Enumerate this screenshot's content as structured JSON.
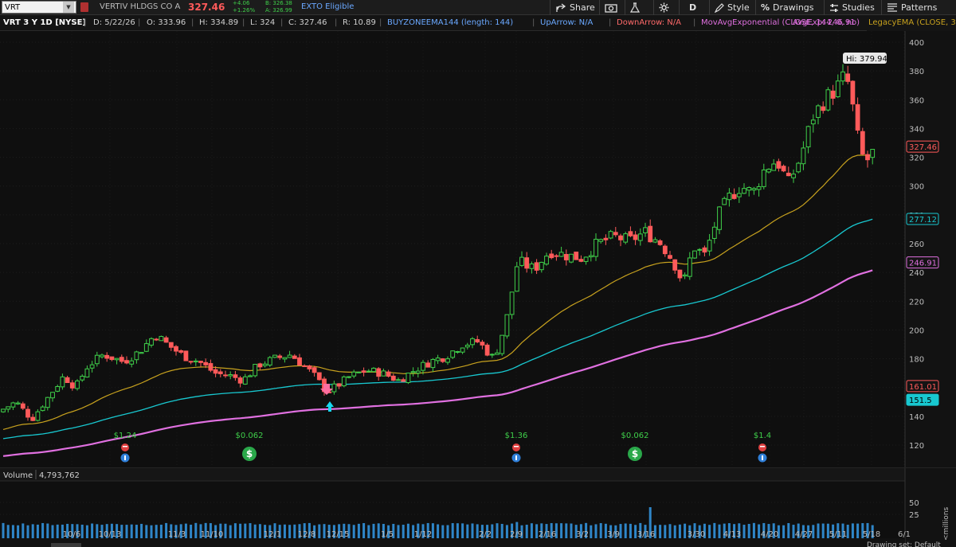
{
  "toolbar": {
    "symbol": "VRT",
    "company": "VERTIV HLDGS CO A",
    "last_price": "327.46",
    "change": "+4.06",
    "change_pct": "+1.26%",
    "bid": "B: 326.38",
    "ask": "A: 326.99",
    "exto": "EXTO Eligible",
    "share": "Share",
    "period": "D",
    "style": "Style",
    "drawings": "Drawings",
    "studies": "Studies",
    "patterns": "Patterns"
  },
  "info": {
    "title": "VRT 3 Y 1D [NYSE]",
    "date": "D: 5/22/26",
    "open": "O: 333.96",
    "high": "H: 334.89",
    "low": "L: 324",
    "close": "C: 327.46",
    "range": "R: 10.89",
    "buyzone": "BUYZONEEMA144 (length: 144)",
    "uparrow": "UpArrow: N/A",
    "downarrow": "DownArrow: N/A",
    "movavg": "MovAvgExponential (CLOSE, 144, 0, no)",
    "avgexp": "AvgExp: 246.91",
    "legacy": "LegacyEMA (CLOSE, 34, 0)"
  },
  "colors": {
    "up": "#3fcf4a",
    "down": "#ff5a5a",
    "ema34": "#c8a21e",
    "ema_cyan": "#18c8d0",
    "ema144": "#e070e0",
    "volume": "#2f86c8"
  },
  "chart_data": {
    "type": "candlestick",
    "ylim": [
      110,
      405
    ],
    "yticks": [
      120,
      140,
      160,
      180,
      200,
      220,
      240,
      260,
      280,
      300,
      320,
      340,
      360,
      380,
      400
    ],
    "xticks": [
      "10/6",
      "10/13",
      "11/3",
      "11/10",
      "12/1",
      "12/8",
      "12/15",
      "1/5",
      "1/12",
      "2/2",
      "2/9",
      "2/16",
      "3/2",
      "3/9",
      "3/16",
      "3/30",
      "4/13",
      "4/20",
      "4/27",
      "5/11",
      "5/18",
      "6/1"
    ],
    "price_labels": [
      {
        "text": "327.46",
        "value": 327.46,
        "color": "#ff5a5a",
        "fill": "#141414"
      },
      {
        "text": "277.12",
        "value": 277.12,
        "color": "#18c8d0",
        "fill": "#141414"
      },
      {
        "text": "246.91",
        "value": 246.91,
        "color": "#e070e0",
        "fill": "#141414"
      },
      {
        "text": "161.01",
        "value": 161.01,
        "color": "#ff5a5a",
        "fill": "#141414"
      },
      {
        "text": "151.5",
        "value": 151.5,
        "color": "#000000",
        "fill": "#18c8d0"
      }
    ],
    "high_label": "Hi: 379.94",
    "high_value": 379.94,
    "events": [
      {
        "text": "$1.24",
        "kind": "earnings"
      },
      {
        "text": "$0.062",
        "kind": "dividend"
      },
      {
        "text": "$1.36",
        "kind": "earnings"
      },
      {
        "text": "$0.062",
        "kind": "dividend"
      },
      {
        "text": "$1.4",
        "kind": "earnings"
      }
    ],
    "volume": {
      "label": "Volume",
      "value": "4,793,762",
      "ticks": [
        50,
        25
      ],
      "ylim": [
        0,
        85
      ],
      "unit": "millions"
    },
    "footer": "Drawing set: Default"
  }
}
